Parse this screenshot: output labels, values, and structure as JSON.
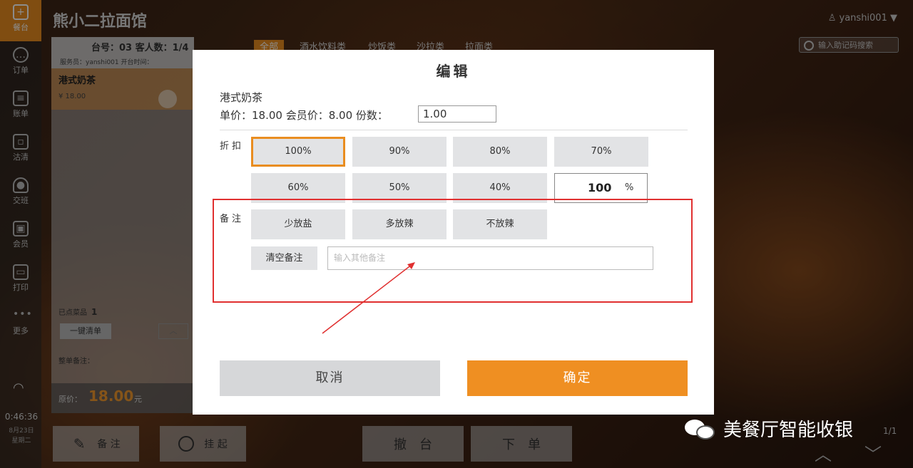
{
  "colors": {
    "accent": "#e98d20",
    "confirm": "#ef8f22",
    "highlight_box": "#e03030"
  },
  "sidebar": {
    "items": [
      {
        "label": "餐台",
        "icon": "plus-icon",
        "active": true
      },
      {
        "label": "订单",
        "icon": "chat-icon",
        "active": false
      },
      {
        "label": "账单",
        "icon": "list-icon",
        "active": false
      },
      {
        "label": "沽清",
        "icon": "document-icon",
        "active": false
      },
      {
        "label": "交班",
        "icon": "user-icon",
        "active": false
      },
      {
        "label": "会员",
        "icon": "member-card-icon",
        "active": false
      },
      {
        "label": "打印",
        "icon": "printer-icon",
        "active": false
      },
      {
        "label": "更多",
        "icon": "more-dots-icon",
        "active": false
      }
    ],
    "clock": "0:46:36",
    "date": "8月23日",
    "weekday": "星期二"
  },
  "header": {
    "app_title": "熊小二拉面馆",
    "user": "yanshi001",
    "search_placeholder": "输入助记码搜索"
  },
  "order_panel": {
    "table_info": "台号：03  客人数：1/4",
    "staff_info": "服务员：yanshi001    开台时间：",
    "item_name": "港式奶茶",
    "item_price": "¥ 18.00",
    "count_label": "已点菜品",
    "count_value": "1",
    "clear_button": "一键清单",
    "order_note_label": "整单备注：",
    "total_label": "原价：",
    "total_amount": "18.00",
    "total_unit": "元"
  },
  "categories": [
    "全部",
    "酒水饮料类",
    "炒饭类",
    "沙拉类",
    "拉面类"
  ],
  "bottom_bar": {
    "note_button": "备 注",
    "hold_button": "挂 起",
    "cancel_table_button": "撤　台",
    "place_order_button": "下　单",
    "page_info": "1/1"
  },
  "watermark": "美餐厅智能收银",
  "modal": {
    "title": "编辑",
    "item_name": "港式奶茶",
    "price_text": "单价：18.00   会员价：8.00  份数：",
    "quantity": "1.00",
    "discount_label": "折扣",
    "discount_options": [
      "100%",
      "90%",
      "80%",
      "70%",
      "60%",
      "50%",
      "40%"
    ],
    "selected_discount": "100%",
    "custom_discount_value": "100",
    "custom_discount_unit": "%",
    "note_label": "备注",
    "note_options": [
      "少放盐",
      "多放辣",
      "不放辣"
    ],
    "clear_note_button": "清空备注",
    "note_placeholder": "输入其他备注",
    "cancel_button": "取消",
    "confirm_button": "确定"
  }
}
